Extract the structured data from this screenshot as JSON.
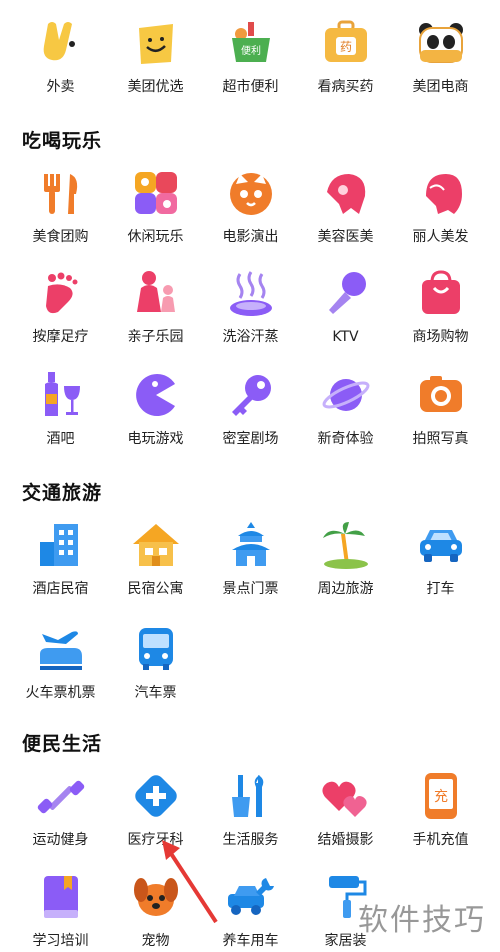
{
  "top_row": [
    {
      "label": "外卖",
      "icon": "rabbit-icon"
    },
    {
      "label": "美团优选",
      "icon": "smiley-bag-icon"
    },
    {
      "label": "超市便利",
      "icon": "grocery-basket-icon",
      "badge": "便利"
    },
    {
      "label": "看病买药",
      "icon": "medicine-box-icon",
      "badge": "药"
    },
    {
      "label": "美团电商",
      "icon": "panda-icon"
    }
  ],
  "sections": [
    {
      "title": "吃喝玩乐",
      "rows": [
        [
          {
            "label": "美食团购",
            "icon": "fork-knife-icon"
          },
          {
            "label": "休闲玩乐",
            "icon": "leisure-grid-icon"
          },
          {
            "label": "电影演出",
            "icon": "cat-face-icon"
          },
          {
            "label": "美容医美",
            "icon": "beauty-hair-icon"
          },
          {
            "label": "丽人美发",
            "icon": "hair-profile-icon"
          }
        ],
        [
          {
            "label": "按摩足疗",
            "icon": "foot-icon"
          },
          {
            "label": "亲子乐园",
            "icon": "parent-child-icon"
          },
          {
            "label": "洗浴汗蒸",
            "icon": "hot-spring-icon"
          },
          {
            "label": "KTV",
            "icon": "microphone-icon"
          },
          {
            "label": "商场购物",
            "icon": "shopping-bag-icon"
          }
        ],
        [
          {
            "label": "酒吧",
            "icon": "wine-bottle-icon"
          },
          {
            "label": "电玩游戏",
            "icon": "pacman-icon"
          },
          {
            "label": "密室剧场",
            "icon": "key-icon"
          },
          {
            "label": "新奇体验",
            "icon": "planet-icon"
          },
          {
            "label": "拍照写真",
            "icon": "camera-icon"
          }
        ]
      ]
    },
    {
      "title": "交通旅游",
      "rows": [
        [
          {
            "label": "酒店民宿",
            "icon": "hotel-building-icon"
          },
          {
            "label": "民宿公寓",
            "icon": "house-icon"
          },
          {
            "label": "景点门票",
            "icon": "temple-icon"
          },
          {
            "label": "周边旅游",
            "icon": "palm-tree-icon"
          },
          {
            "label": "打车",
            "icon": "car-icon"
          }
        ],
        [
          {
            "label": "火车票机票",
            "icon": "train-plane-icon"
          },
          {
            "label": "汽车票",
            "icon": "bus-icon"
          }
        ]
      ]
    },
    {
      "title": "便民生活",
      "rows": [
        [
          {
            "label": "运动健身",
            "icon": "dumbbell-icon"
          },
          {
            "label": "医疗牙科",
            "icon": "medical-cross-icon"
          },
          {
            "label": "生活服务",
            "icon": "tools-icon"
          },
          {
            "label": "结婚摄影",
            "icon": "hearts-icon"
          },
          {
            "label": "手机充值",
            "icon": "phone-recharge-icon",
            "badge": "充"
          }
        ],
        [
          {
            "label": "学习培训",
            "icon": "book-icon"
          },
          {
            "label": "宠物",
            "icon": "dog-icon"
          },
          {
            "label": "养车用车",
            "icon": "car-wrench-icon"
          },
          {
            "label": "家居装",
            "icon": "paint-roller-icon"
          }
        ]
      ]
    }
  ],
  "watermark": {
    "text": "软件技巧"
  }
}
